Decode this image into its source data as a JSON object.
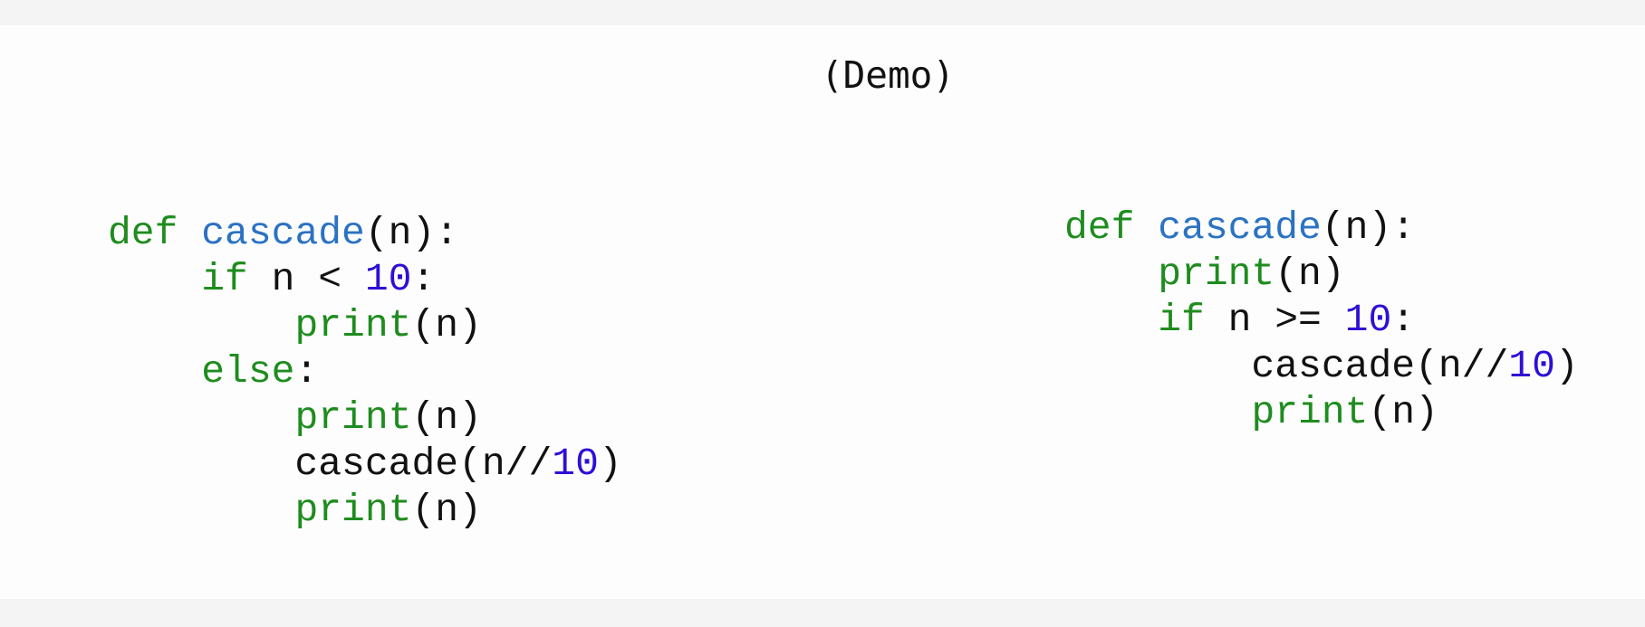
{
  "title": "(Demo)",
  "colors": {
    "keyword": "#1e8c1e",
    "function_name": "#2b72c2",
    "number": "#2d0fd6",
    "text": "#111111"
  },
  "left_code": [
    [
      {
        "t": "def",
        "c": "kw"
      },
      {
        "t": " ",
        "c": "tx"
      },
      {
        "t": "cascade",
        "c": "fn"
      },
      {
        "t": "(n):",
        "c": "tx"
      }
    ],
    [
      {
        "t": "    ",
        "c": "tx"
      },
      {
        "t": "if",
        "c": "kw"
      },
      {
        "t": " n < ",
        "c": "tx"
      },
      {
        "t": "10",
        "c": "num"
      },
      {
        "t": ":",
        "c": "tx"
      }
    ],
    [
      {
        "t": "        ",
        "c": "tx"
      },
      {
        "t": "print",
        "c": "kw"
      },
      {
        "t": "(n)",
        "c": "tx"
      }
    ],
    [
      {
        "t": "    ",
        "c": "tx"
      },
      {
        "t": "else",
        "c": "kw"
      },
      {
        "t": ":",
        "c": "tx"
      }
    ],
    [
      {
        "t": "        ",
        "c": "tx"
      },
      {
        "t": "print",
        "c": "kw"
      },
      {
        "t": "(n)",
        "c": "tx"
      }
    ],
    [
      {
        "t": "        cascade(n//",
        "c": "tx"
      },
      {
        "t": "10",
        "c": "num"
      },
      {
        "t": ")",
        "c": "tx"
      }
    ],
    [
      {
        "t": "        ",
        "c": "tx"
      },
      {
        "t": "print",
        "c": "kw"
      },
      {
        "t": "(n)",
        "c": "tx"
      }
    ]
  ],
  "right_code": [
    [
      {
        "t": "def",
        "c": "kw"
      },
      {
        "t": " ",
        "c": "tx"
      },
      {
        "t": "cascade",
        "c": "fn"
      },
      {
        "t": "(n):",
        "c": "tx"
      }
    ],
    [
      {
        "t": "    ",
        "c": "tx"
      },
      {
        "t": "print",
        "c": "kw"
      },
      {
        "t": "(n)",
        "c": "tx"
      }
    ],
    [
      {
        "t": "    ",
        "c": "tx"
      },
      {
        "t": "if",
        "c": "kw"
      },
      {
        "t": " n >= ",
        "c": "tx"
      },
      {
        "t": "10",
        "c": "num"
      },
      {
        "t": ":",
        "c": "tx"
      }
    ],
    [
      {
        "t": "        cascade(n//",
        "c": "tx"
      },
      {
        "t": "10",
        "c": "num"
      },
      {
        "t": ")",
        "c": "tx"
      }
    ],
    [
      {
        "t": "        ",
        "c": "tx"
      },
      {
        "t": "print",
        "c": "kw"
      },
      {
        "t": "(n)",
        "c": "tx"
      }
    ]
  ]
}
